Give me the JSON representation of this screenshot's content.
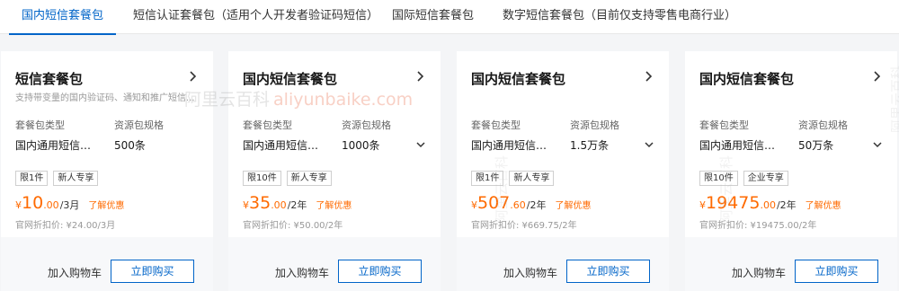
{
  "tabs": [
    {
      "label": "国内短信套餐包",
      "active": true
    },
    {
      "label": "短信认证套餐包（适用个人开发者验证码短信）",
      "active": false
    },
    {
      "label": "国际短信套餐包",
      "active": false
    },
    {
      "label": "数字短信套餐包（目前仅支持零售电商行业）",
      "active": false
    }
  ],
  "labels": {
    "type": "套餐包类型",
    "spec": "资源包规格",
    "add_cart": "加入购物车",
    "buy": "立即购买",
    "learn_more": "了解优惠"
  },
  "cards": [
    {
      "title": "短信套餐包",
      "desc": "支持带变量的国内验证码、通知和推广短信...",
      "type_value": "国内通用短信套餐包",
      "spec_value": "500条",
      "tags": [
        "限1件",
        "新人专享"
      ],
      "currency": "¥",
      "price_int": "10",
      "price_dec": ".00",
      "price_unit": "/3月",
      "orig_price": "官网折扣价: ¥24.00/3月"
    },
    {
      "title": "国内短信套餐包",
      "desc": "",
      "type_value": "国内通用短信套餐包",
      "spec_value": "1000条",
      "tags": [
        "限10件",
        "新人专享"
      ],
      "currency": "¥",
      "price_int": "35",
      "price_dec": ".00",
      "price_unit": "/2年",
      "orig_price": "官网折扣价: ¥50.00/2年"
    },
    {
      "title": "国内短信套餐包",
      "desc": "",
      "type_value": "国内通用短信套餐包",
      "spec_value": "1.5万条",
      "tags": [
        "限1件",
        "新人专享"
      ],
      "currency": "¥",
      "price_int": "507",
      "price_dec": ".60",
      "price_unit": "/2年",
      "orig_price": "官网折扣价: ¥669.75/2年"
    },
    {
      "title": "国内短信套餐包",
      "desc": "",
      "type_value": "国内通用短信套餐包",
      "spec_value": "50万条",
      "tags": [
        "限10件",
        "企业专享"
      ],
      "currency": "¥",
      "price_int": "19475",
      "price_dec": ".00",
      "price_unit": "/2年",
      "orig_price": "官网折扣价: ¥19475.00/2年"
    }
  ],
  "watermark": {
    "cn": "阿里云百科",
    "latin": "aliyunbaike.com"
  },
  "colors": {
    "accent": "#0064c8",
    "price": "#ff6a00"
  }
}
